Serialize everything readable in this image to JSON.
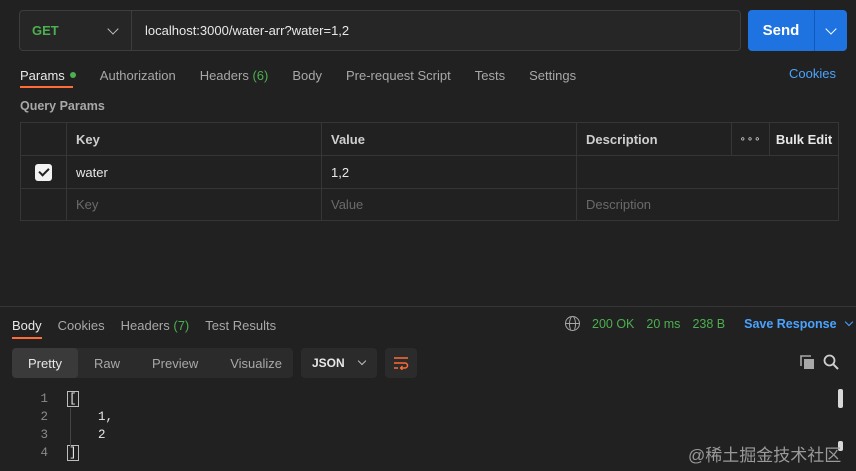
{
  "request": {
    "method": "GET",
    "url": "localhost:3000/water-arr?water=1,2",
    "send_label": "Send"
  },
  "request_tabs": [
    {
      "label": "Params",
      "active": true
    },
    {
      "label": "Authorization"
    },
    {
      "label": "Headers",
      "count": "(6)"
    },
    {
      "label": "Body"
    },
    {
      "label": "Pre-request Script"
    },
    {
      "label": "Tests"
    },
    {
      "label": "Settings"
    }
  ],
  "cookies_link": "Cookies",
  "query_params": {
    "section_label": "Query Params",
    "columns": {
      "key": "Key",
      "value": "Value",
      "description": "Description",
      "more": "∘∘∘",
      "bulk_edit": "Bulk Edit"
    },
    "rows": [
      {
        "checked": true,
        "key": "water",
        "value": "1,2",
        "description": ""
      }
    ],
    "placeholders": {
      "key": "Key",
      "value": "Value",
      "description": "Description"
    }
  },
  "response_tabs": [
    {
      "label": "Body",
      "active": true
    },
    {
      "label": "Cookies"
    },
    {
      "label": "Headers",
      "count": "(7)"
    },
    {
      "label": "Test Results"
    }
  ],
  "response_meta": {
    "status": "200 OK",
    "time": "20 ms",
    "size": "238 B",
    "save_label": "Save Response"
  },
  "view_modes": [
    {
      "label": "Pretty",
      "active": true
    },
    {
      "label": "Raw"
    },
    {
      "label": "Preview"
    },
    {
      "label": "Visualize"
    }
  ],
  "format": "JSON",
  "code_lines": [
    {
      "num": "1",
      "text": "["
    },
    {
      "num": "2",
      "text": "    1,"
    },
    {
      "num": "3",
      "text": "    2"
    },
    {
      "num": "4",
      "text": "]"
    }
  ],
  "watermark": "@稀土掘金技术社区",
  "colors": {
    "accent": "#ff6c37",
    "primary": "#1f73e0",
    "success": "#4caf50",
    "link": "#4aa3ff"
  }
}
